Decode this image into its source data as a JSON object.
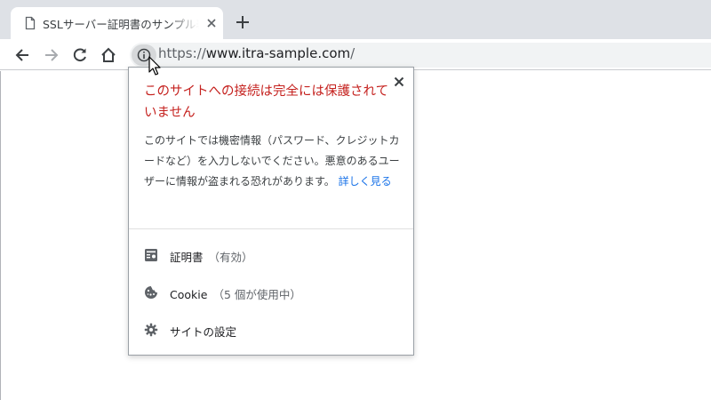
{
  "tab": {
    "title": "SSLサーバー証明書のサンプル表示",
    "favicon": "page-icon",
    "close_icon": "close-icon"
  },
  "newtab_icon": "plus-icon",
  "toolbar": {
    "back_icon": "arrow-left-icon",
    "forward_icon": "arrow-right-icon",
    "reload_icon": "reload-icon",
    "home_icon": "home-icon",
    "info_icon": "info-icon"
  },
  "address": {
    "scheme": "https://",
    "host": "www.itra-sample.com",
    "path": "/"
  },
  "popup": {
    "title": "このサイトへの接続は完全には保護されていません",
    "description": "このサイトでは機密情報（パスワード、クレジットカードなど）を入力しないでください。悪意のあるユーザーに情報が盗まれる恐れがあります。",
    "learn_more": "詳しく見る",
    "items": [
      {
        "label": "証明書",
        "sub": "（有効）",
        "icon": "certificate-icon"
      },
      {
        "label": "Cookie",
        "sub": "（5 個が使用中）",
        "icon": "cookie-icon"
      },
      {
        "label": "サイトの設定",
        "sub": "",
        "icon": "gear-icon"
      }
    ]
  },
  "colors": {
    "warning_title": "#c5221f",
    "link": "#1a73e8",
    "tabstrip_bg": "#dee1e6",
    "omnibox_bg": "#f1f3f4"
  }
}
